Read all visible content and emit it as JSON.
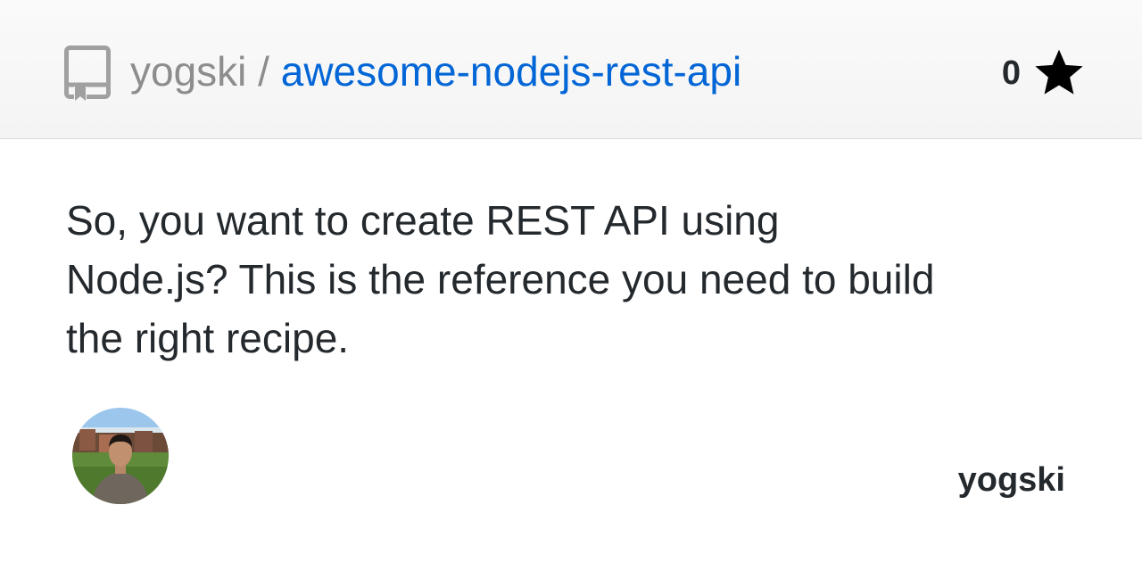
{
  "header": {
    "owner": "yogski",
    "separator": "/",
    "repo_name": "awesome-nodejs-rest-api",
    "repo_icon": "repo-icon",
    "star_count": "0",
    "star_icon": "star-icon"
  },
  "description": "So, you want to create REST API using Node.js? This is the reference you need to build the right recipe.",
  "author": {
    "name": "yogski",
    "avatar_icon": "avatar"
  },
  "colors": {
    "link": "#0366d6",
    "muted": "#8d8d8d",
    "text": "#24292e"
  }
}
